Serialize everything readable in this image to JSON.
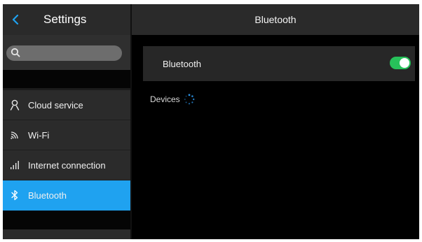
{
  "sidebar": {
    "title": "Settings",
    "search": {
      "placeholder": ""
    },
    "items": [
      {
        "label": "Cloud service",
        "icon": "person-icon",
        "active": false
      },
      {
        "label": "Wi-Fi",
        "icon": "wifi-icon",
        "active": false
      },
      {
        "label": "Internet connection",
        "icon": "signal-bars-icon",
        "active": false
      },
      {
        "label": "Bluetooth",
        "icon": "bluetooth-icon",
        "active": true
      }
    ]
  },
  "main": {
    "title": "Bluetooth",
    "bluetooth_row": {
      "label": "Bluetooth",
      "enabled": true
    },
    "devices": {
      "label": "Devices",
      "scanning": true
    }
  },
  "colors": {
    "accent": "#1fa2f0",
    "toggle_on": "#27c15a",
    "background": "#000000",
    "panel": "#2a2a2a"
  }
}
